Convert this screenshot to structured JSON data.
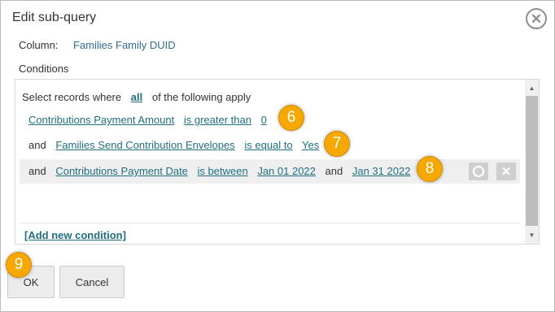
{
  "dialog": {
    "title": "Edit sub-query",
    "column_label": "Column:",
    "column_value": "Families Family DUID",
    "conditions_label": "Conditions"
  },
  "conditions": {
    "intro_prefix": "Select records where",
    "intro_mode": "all",
    "intro_suffix": "of the following apply",
    "rows": [
      {
        "field": "Contributions Payment Amount",
        "operator": "is greater than",
        "value": "0"
      },
      {
        "connector": "and",
        "field": "Families Send Contribution Envelopes",
        "operator": "is equal to",
        "value": "Yes"
      },
      {
        "connector": "and",
        "field": "Contributions Payment Date",
        "operator": "is between",
        "value": "Jan 01 2022",
        "and_word": "and",
        "value2": "Jan 31 2022"
      }
    ],
    "add_link": "[Add new condition]"
  },
  "callouts": {
    "c1": "6",
    "c2": "7",
    "c3": "8",
    "c4": "9"
  },
  "buttons": {
    "ok": "OK",
    "cancel": "Cancel"
  },
  "icons": {
    "close": "close-icon",
    "group": "circle-icon",
    "delete": "x-icon",
    "scroll_up": "triangle-up-icon",
    "scroll_down": "triangle-down-icon"
  },
  "colors": {
    "link": "#1f6f80",
    "callout": "#f6a800",
    "row_highlight": "#efefef"
  }
}
